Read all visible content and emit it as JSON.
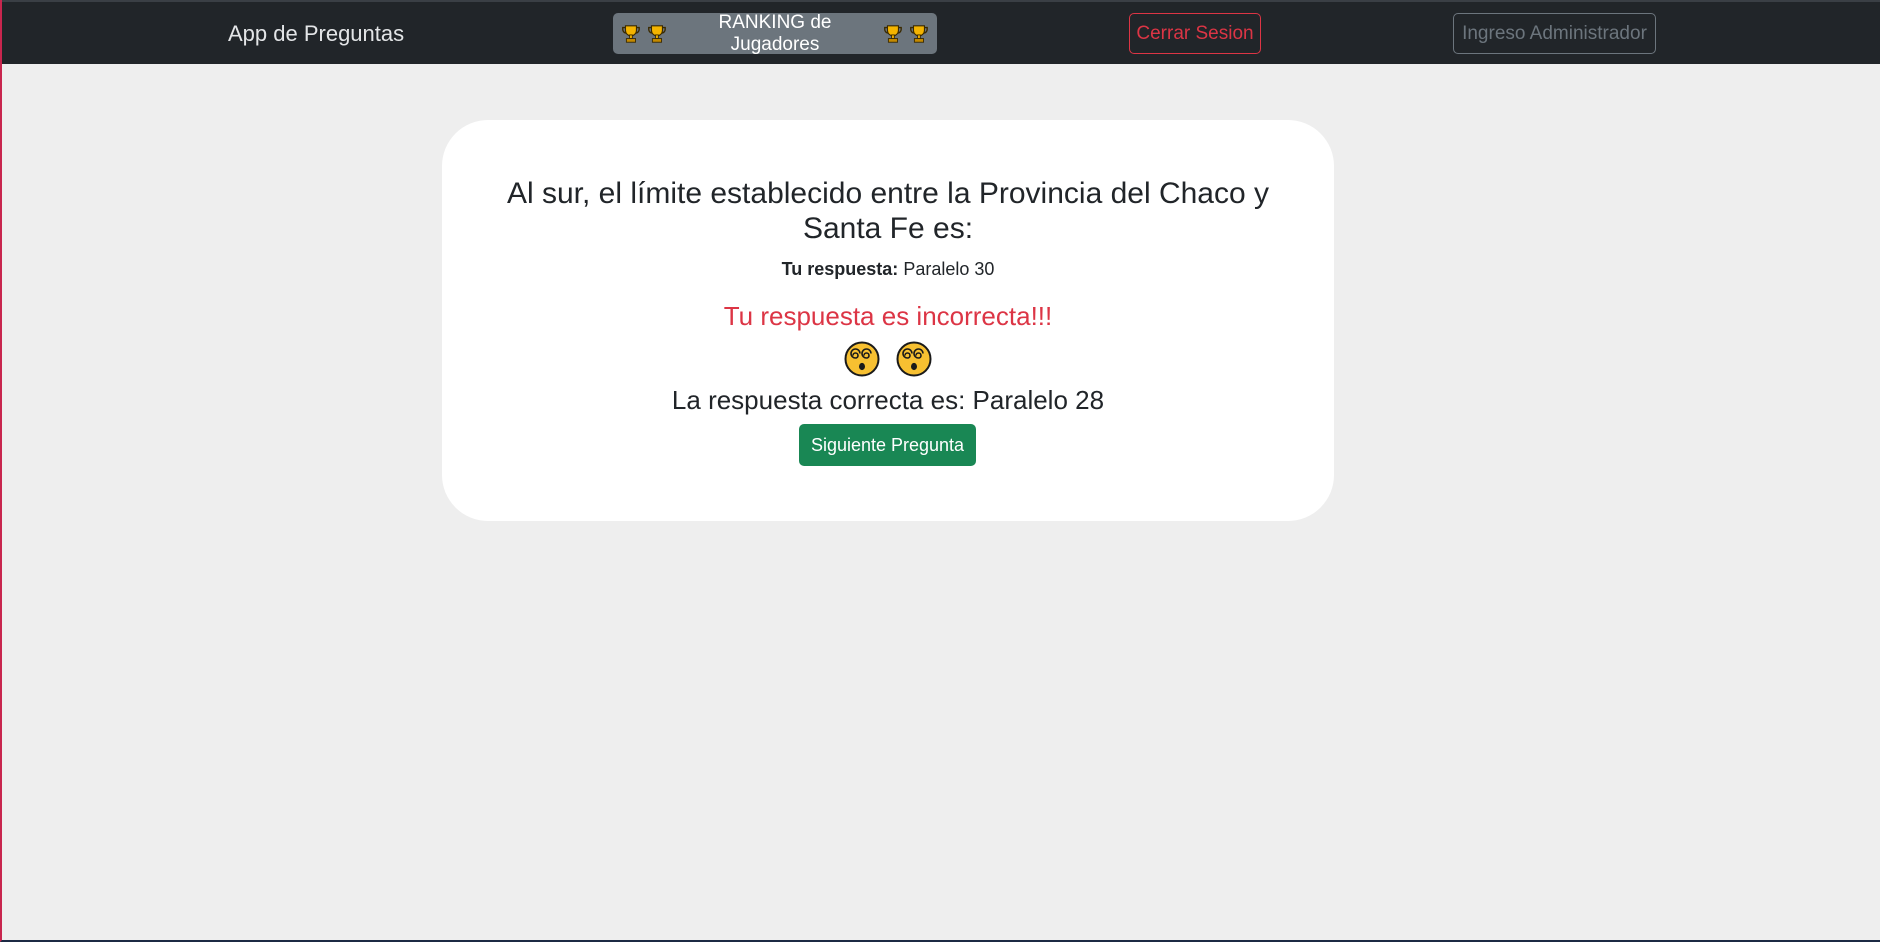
{
  "navbar": {
    "brand": "App de Preguntas",
    "ranking_label": "RANKING de Jugadores",
    "logout_label": "Cerrar Sesion",
    "admin_label": "Ingreso Administrador"
  },
  "icons": {
    "trophy": "trophy-icon",
    "dizzy_face": "dizzy-face-icon"
  },
  "card": {
    "question": "Al sur, el límite establecido entre la Provincia del Chaco y Santa Fe es:",
    "your_answer_label": "Tu respuesta:",
    "your_answer_value": "Paralelo 30",
    "result": "Tu respuesta es incorrecta!!!",
    "correct_answer": "La respuesta correcta es: Paralelo 28",
    "next_label": "Siguiente Pregunta"
  },
  "colors": {
    "navbar_bg": "#212529",
    "ranking_btn": "#6c757d",
    "logout_btn": "#dc3545",
    "admin_btn": "#6c757d",
    "incorrect_text": "#dc3545",
    "next_btn": "#198754",
    "page_bg": "#eeeeee"
  }
}
